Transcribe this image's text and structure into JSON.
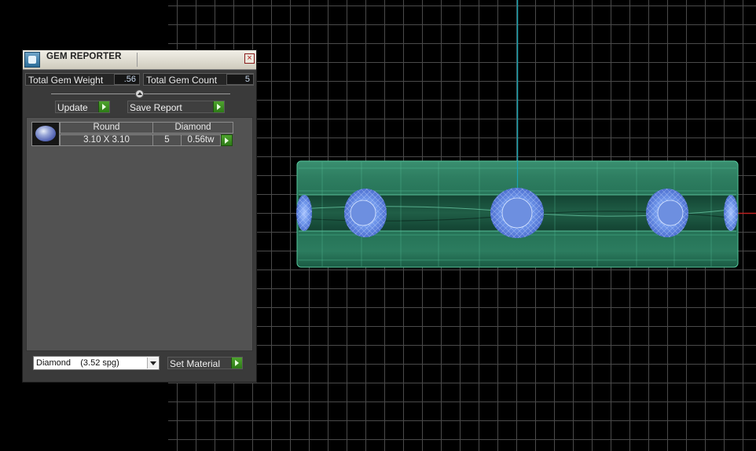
{
  "panel": {
    "title": "GEM REPORTER",
    "total_gem_weight_label": "Total Gem Weight",
    "total_gem_weight_value": ".56",
    "total_gem_count_label": "Total Gem Count",
    "total_gem_count_value": "5",
    "update_label": "Update",
    "save_report_label": "Save Report",
    "gems": [
      {
        "shape": "Round",
        "material": "Diamond",
        "size": "3.10 X 3.10",
        "count": "5",
        "weight": "0.56tw"
      }
    ],
    "material_select_value": "Diamond    (3.52 spg)",
    "set_material_label": "Set Material"
  },
  "colors": {
    "viewport_bg": "#000000",
    "grid_line": "#505050",
    "axis_vertical": "#1aa3b0",
    "axis_horizontal": "#c02020",
    "ring_body": "#2a8a6a",
    "gem_wire": "#7aa8ff",
    "play_button": "#3a8d22"
  }
}
